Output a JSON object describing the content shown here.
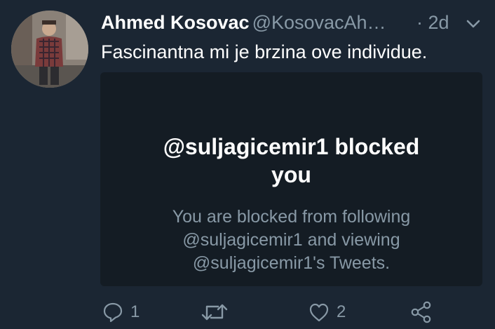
{
  "tweet": {
    "display_name": "Ahmed Kosovac",
    "handle": "@KosovacAh…",
    "time": "· 2d",
    "text": "Fascinantna mi je brzina ove individue.",
    "avatar_icon": "user-photo"
  },
  "card": {
    "title_line1": "@suljagicemir1 blocked",
    "title_line2": "you",
    "body_line1": "You are blocked from following",
    "body_line2": "@suljagicemir1 and viewing",
    "body_line3": "@suljagicemir1's Tweets."
  },
  "actions": {
    "reply_count": "1",
    "like_count": "2",
    "icons": [
      "reply-icon",
      "retweet-icon",
      "like-icon",
      "share-icon"
    ]
  },
  "colors": {
    "background": "#1b2633",
    "card": "#141c24",
    "muted": "#8899a6",
    "text": "#ffffff"
  }
}
